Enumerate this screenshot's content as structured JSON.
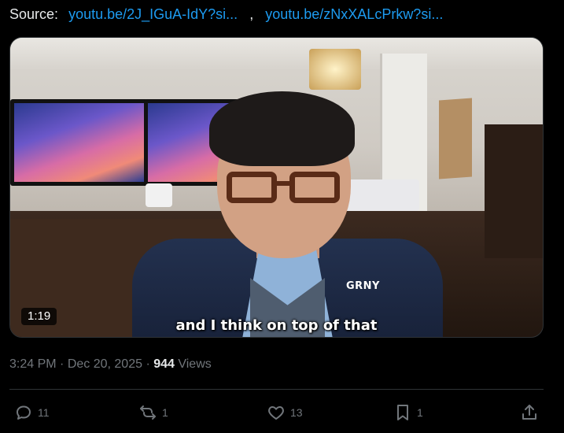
{
  "source": {
    "label": "Source:",
    "links": [
      "youtu.be/2J_IGuA-IdY?si...",
      "youtu.be/zNxXALcPrkw?si..."
    ],
    "separator": ","
  },
  "video": {
    "subtitle": "and I think on top of that",
    "duration": "1:19",
    "pin_text": "GRNY"
  },
  "meta": {
    "time": "3:24 PM",
    "dot1": " · ",
    "date": "Dec 20, 2025",
    "dot2": " · ",
    "views_count": "944",
    "views_label": " Views"
  },
  "actions": {
    "reply_count": "11",
    "repost_count": "1",
    "like_count": "13",
    "bookmark_count": "1"
  },
  "colors": {
    "background": "#000000",
    "link": "#1d9bf0",
    "muted": "#71767b",
    "text": "#e7e9ea"
  }
}
